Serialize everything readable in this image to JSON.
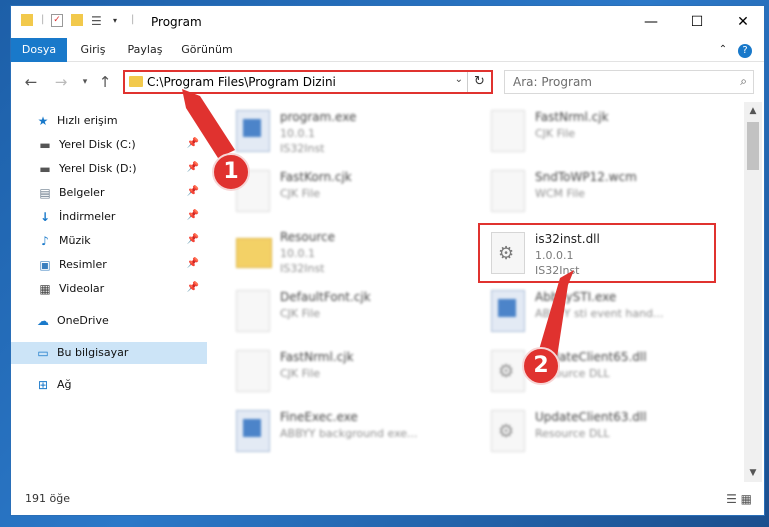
{
  "window": {
    "title": "Program"
  },
  "ribbon": {
    "tabs": [
      "Dosya",
      "Giriş",
      "Paylaş",
      "Görünüm"
    ]
  },
  "address": {
    "path": "C:\\Program Files\\Program Dizini"
  },
  "search": {
    "placeholder": "Ara: Program"
  },
  "sidebar": {
    "items": [
      {
        "label": "Hızlı erişim",
        "icon": "star-icon"
      },
      {
        "label": "Yerel Disk (C:)",
        "icon": "drive-icon",
        "pinned": true
      },
      {
        "label": "Yerel Disk (D:)",
        "icon": "drive-icon",
        "pinned": true
      },
      {
        "label": "Belgeler",
        "icon": "documents-icon",
        "pinned": true
      },
      {
        "label": "İndirmeler",
        "icon": "download-icon",
        "pinned": true
      },
      {
        "label": "Müzik",
        "icon": "music-icon",
        "pinned": true
      },
      {
        "label": "Resimler",
        "icon": "pictures-icon",
        "pinned": true
      },
      {
        "label": "Videolar",
        "icon": "video-icon",
        "pinned": true
      },
      {
        "label": "OneDrive",
        "icon": "cloud-icon"
      },
      {
        "label": "Bu bilgisayar",
        "icon": "computer-icon",
        "selected": true
      },
      {
        "label": "Ağ",
        "icon": "network-icon"
      }
    ]
  },
  "files": {
    "left": [
      {
        "name": "program.exe",
        "line2": "10.0.1",
        "line3": "IS32Inst",
        "kind": "exe"
      },
      {
        "name": "FastKorn.cjk",
        "line2": "CJK File",
        "line3": "",
        "kind": "doc"
      },
      {
        "name": "Resource",
        "line2": "10.0.1",
        "line3": "IS32Inst",
        "kind": "folder"
      },
      {
        "name": "DefaultFont.cjk",
        "line2": "CJK File",
        "line3": "",
        "kind": "doc"
      },
      {
        "name": "FastNrml.cjk",
        "line2": "CJK File",
        "line3": "",
        "kind": "doc"
      },
      {
        "name": "FineExec.exe",
        "line2": "ABBYY background exe...",
        "line3": "",
        "kind": "exe"
      }
    ],
    "right": [
      {
        "name": "FastNrml.cjk",
        "line2": "CJK File",
        "line3": "",
        "kind": "doc"
      },
      {
        "name": "SndToWP12.wcm",
        "line2": "WCM File",
        "line3": "",
        "kind": "doc"
      },
      {
        "name": "is32inst.dll",
        "line2": "1.0.0.1",
        "line3": "IS32Inst",
        "kind": "dll",
        "highlight": true
      },
      {
        "name": "AbbyySTI.exe",
        "line2": "ABBYY sti event hand...",
        "line3": "",
        "kind": "exe"
      },
      {
        "name": "UpdateClient65.dll",
        "line2": "Resource DLL",
        "line3": "",
        "kind": "dll"
      },
      {
        "name": "UpdateClient63.dll",
        "line2": "Resource DLL",
        "line3": "",
        "kind": "dll"
      }
    ]
  },
  "status": {
    "count": "191 öğe"
  },
  "annotations": {
    "badge1": "1",
    "badge2": "2",
    "color": "#e0322f"
  }
}
